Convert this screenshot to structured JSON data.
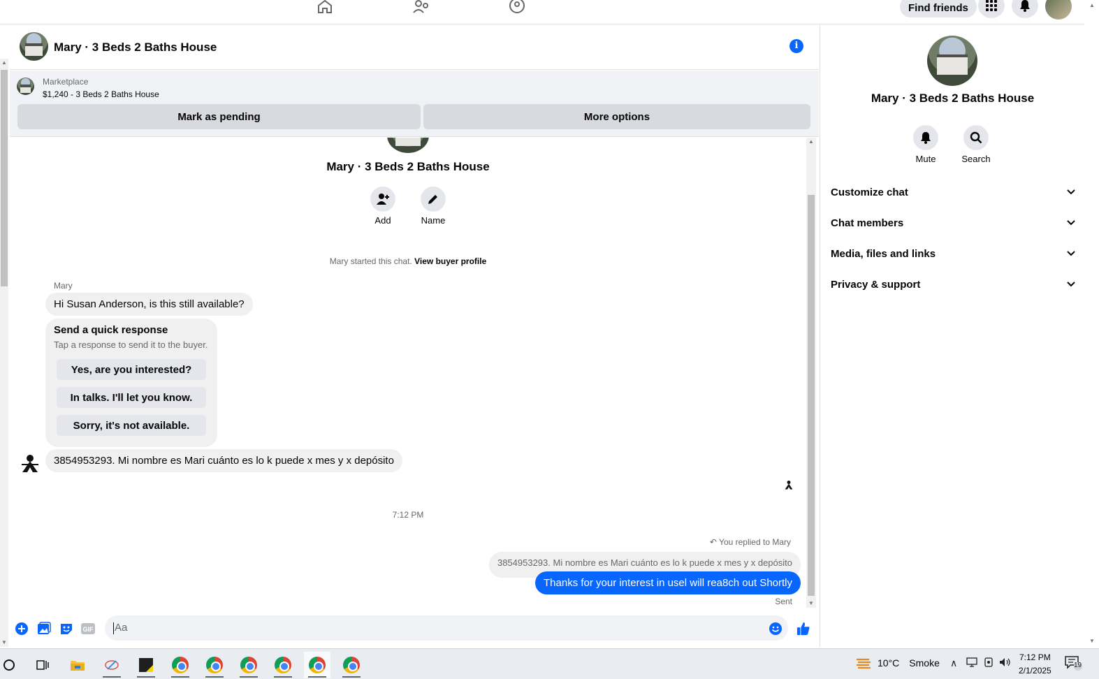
{
  "nav": {
    "find_friends": "Find friends"
  },
  "chat": {
    "title": "Mary · 3 Beds 2 Baths House",
    "marketplace_label": "Marketplace",
    "listing": "$1,240 - 3 Beds 2 Baths House",
    "mark_pending": "Mark as pending",
    "more_options": "More options",
    "center_name": "Mary · 3 Beds 2 Baths House",
    "add_label": "Add",
    "name_label": "Name",
    "started_text": "Mary started this chat.",
    "view_buyer_profile": "View buyer profile",
    "sender_name": "Mary",
    "msg_1": "Hi Susan Anderson, is this still available?",
    "quick_title": "Send a quick response",
    "quick_sub": "Tap a response to send it to the buyer.",
    "quick_options": [
      "Yes, are you interested?",
      "In talks. I'll let you know.",
      "Sorry, it's not available."
    ],
    "msg_2": "3854953293. Mi nombre es Mari cuánto es lo k puede x mes y x depósito",
    "time_sep": "7:12 PM",
    "replied_to": "You replied to Mary",
    "reply_quote": "3854953293. Mi nombre es Mari cuánto es lo k puede x mes y x depósito",
    "msg_out": "Thanks for your interest in usel will rea8ch out Shortly",
    "sent_status": "Sent",
    "input_placeholder": "Aa"
  },
  "right_panel": {
    "title": "Mary · 3 Beds 2 Baths House",
    "mute": "Mute",
    "search": "Search",
    "sections": [
      "Customize chat",
      "Chat members",
      "Media, files and links",
      "Privacy & support"
    ]
  },
  "taskbar": {
    "weather_temp": "10°C",
    "weather_text": "Smoke",
    "time": "7:12 PM",
    "date": "2/1/2025",
    "notif_count": "19"
  },
  "colors": {
    "accent": "#0866ff",
    "bubble_in": "#f0f0f0",
    "button_gray": "#e4e6eb"
  }
}
